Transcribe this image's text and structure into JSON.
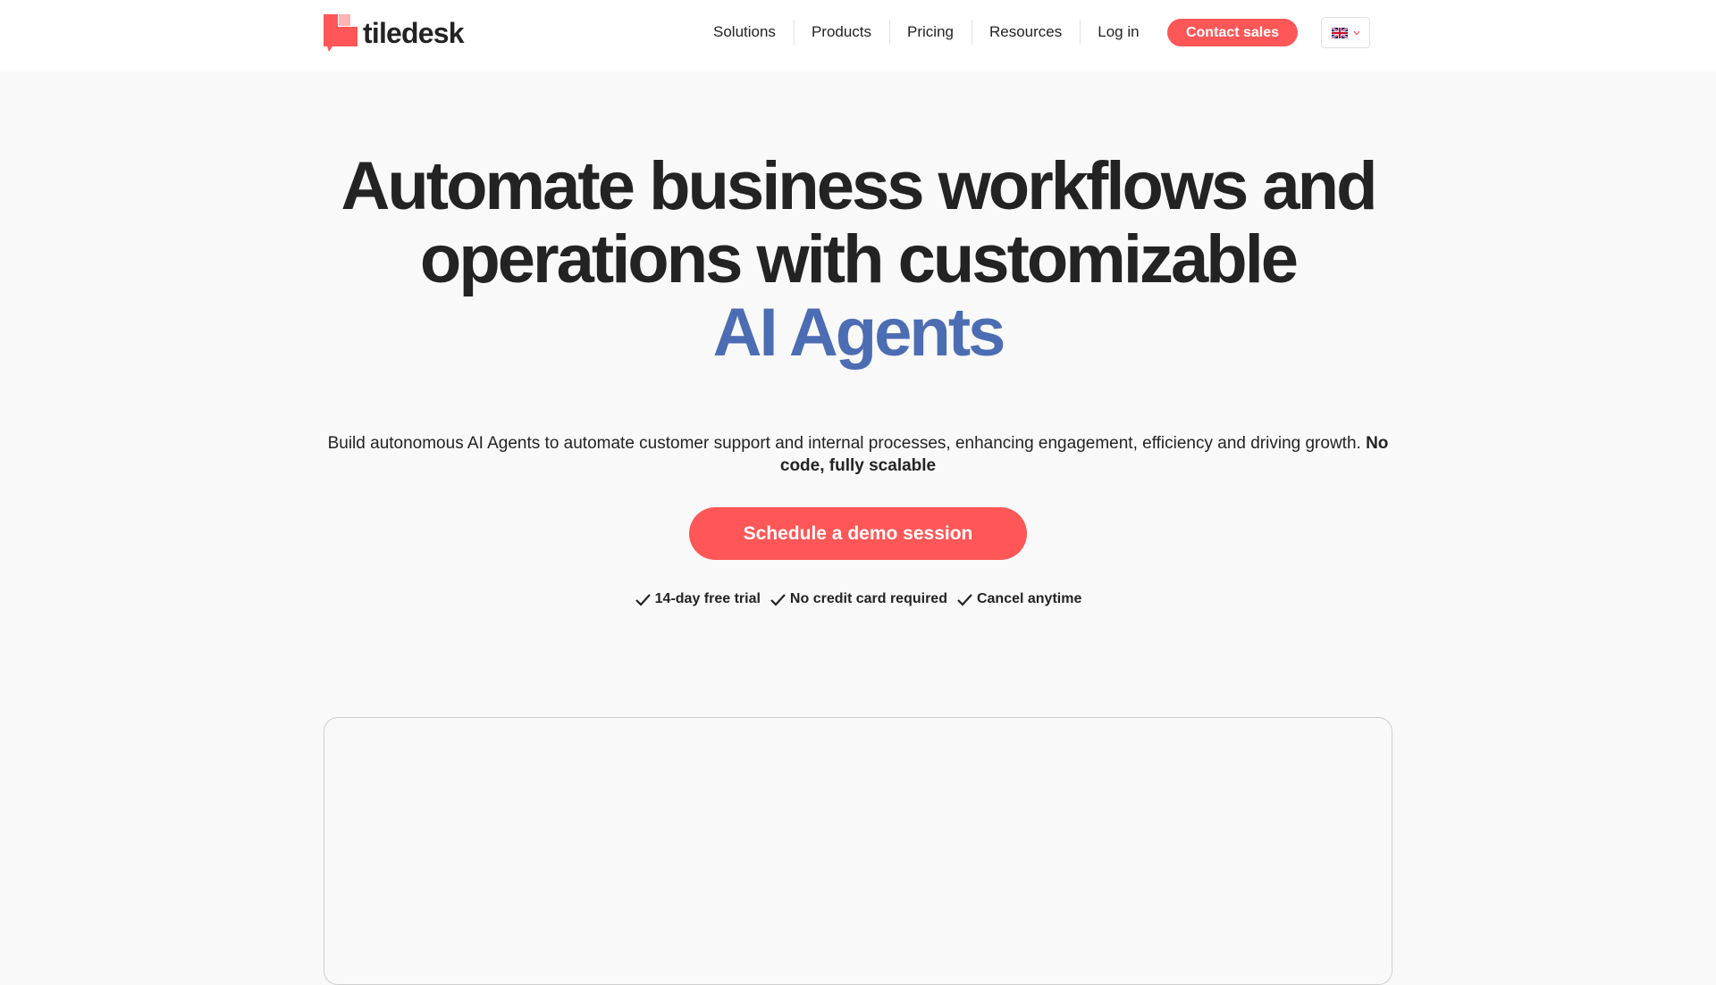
{
  "brand": {
    "name": "tiledesk",
    "primary_color": "#ff5757",
    "accent_color": "#4c6db3",
    "text_color": "#232323"
  },
  "nav": {
    "items": [
      {
        "label": "Solutions"
      },
      {
        "label": "Products"
      },
      {
        "label": "Pricing"
      },
      {
        "label": "Resources"
      },
      {
        "label": "Log in"
      }
    ],
    "contact_label": "Contact sales",
    "language_icon": "uk-flag-icon"
  },
  "hero": {
    "title_line1": "Automate business workflows and",
    "title_line2": "operations with customizable",
    "title_accent": "AI Agents",
    "subtitle": "Build autonomous AI Agents to automate customer support and internal processes, enhancing engagement, efficiency and driving growth.",
    "subtitle_bold": "No code, fully scalable",
    "cta_label": "Schedule a demo session",
    "features": [
      {
        "label": "14-day free trial"
      },
      {
        "label": "No credit card required"
      },
      {
        "label": "Cancel anytime"
      }
    ]
  }
}
